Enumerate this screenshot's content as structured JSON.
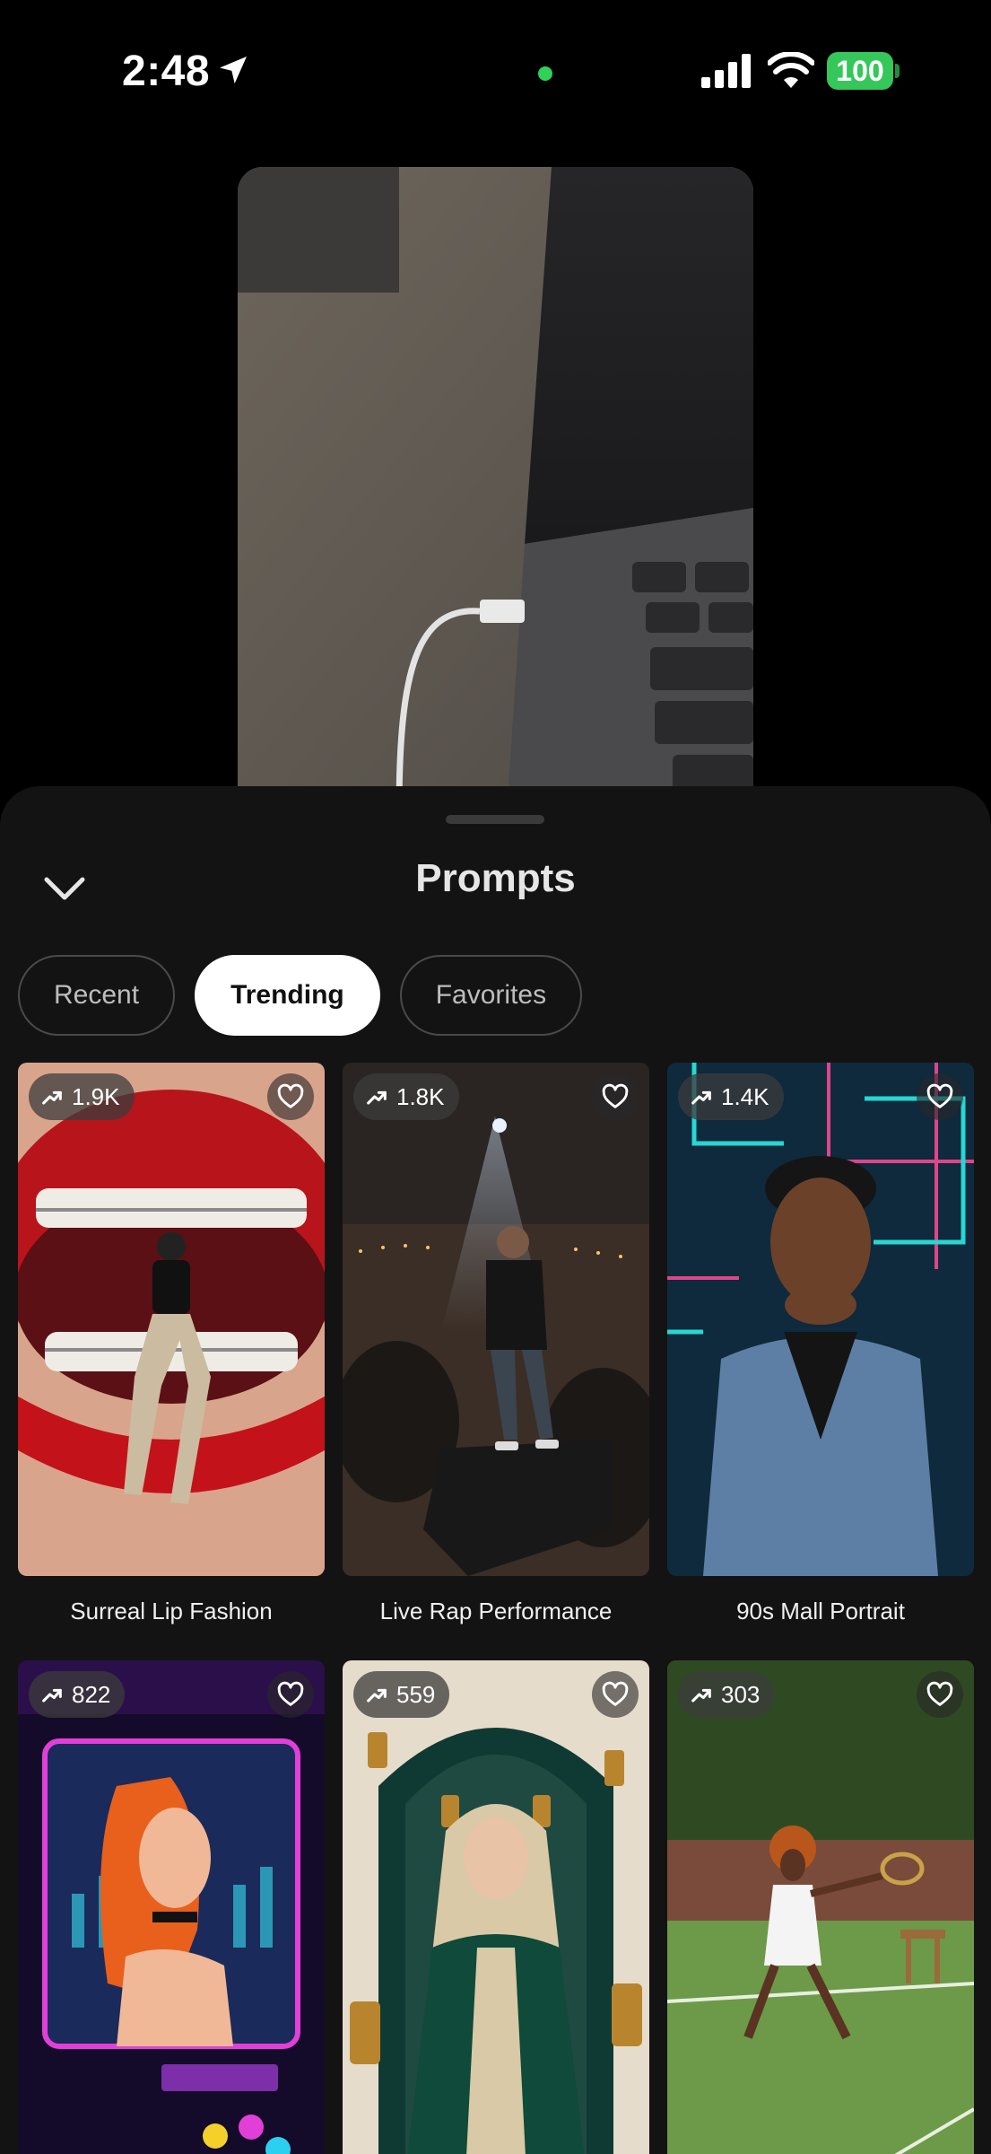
{
  "status_bar": {
    "time": "2:48",
    "battery": "100",
    "battery_color": "#35c759",
    "privacy_dot_color": "#2fd158",
    "icons": [
      "location-arrow-icon",
      "cellular-signal-icon",
      "wifi-icon",
      "battery-icon"
    ]
  },
  "sheet": {
    "title": "Prompts",
    "collapse_icon": "chevron-down-icon",
    "tabs": [
      {
        "label": "Recent",
        "active": false
      },
      {
        "label": "Trending",
        "active": true
      },
      {
        "label": "Favorites",
        "active": false
      }
    ],
    "accent_active_tab_bg": "#ffffff"
  },
  "prompts": [
    {
      "title": "Surreal Lip Fashion",
      "count": "1.9K",
      "trend_icon": "trending-up-icon",
      "favorite_icon": "heart-outline-icon"
    },
    {
      "title": "Live Rap Performance",
      "count": "1.8K",
      "trend_icon": "trending-up-icon",
      "favorite_icon": "heart-outline-icon"
    },
    {
      "title": "90s Mall Portrait",
      "count": "1.4K",
      "trend_icon": "trending-up-icon",
      "favorite_icon": "heart-outline-icon"
    },
    {
      "title": "",
      "count": "822",
      "trend_icon": "trending-up-icon",
      "favorite_icon": "heart-outline-icon"
    },
    {
      "title": "",
      "count": "559",
      "trend_icon": "trending-up-icon",
      "favorite_icon": "heart-outline-icon"
    },
    {
      "title": "",
      "count": "303",
      "trend_icon": "trending-up-icon",
      "favorite_icon": "heart-outline-icon"
    }
  ]
}
